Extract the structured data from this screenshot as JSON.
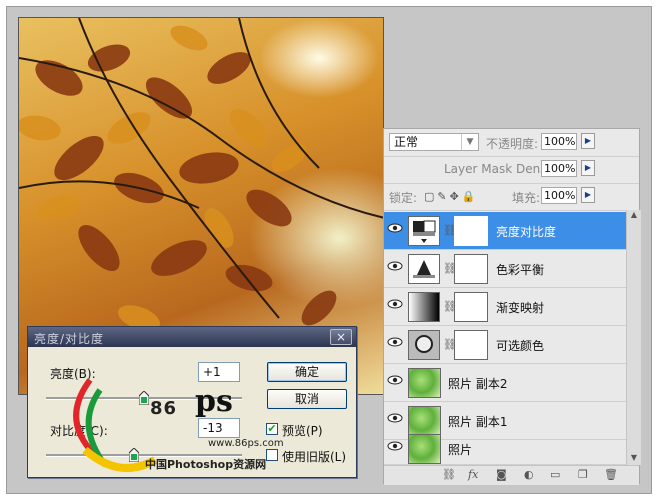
{
  "layers_panel": {
    "blend_mode": "正常",
    "opacity_label": "不透明度:",
    "opacity_value": "100%",
    "density_label": "Layer Mask Density",
    "density_value": "100%",
    "lock_label": "锁定:",
    "fill_label": "填充:",
    "fill_value": "100%",
    "layers": [
      {
        "name": "亮度对比度",
        "selected": true
      },
      {
        "name": "色彩平衡",
        "selected": false
      },
      {
        "name": "渐变映射",
        "selected": false
      },
      {
        "name": "可选颜色",
        "selected": false
      },
      {
        "name": "照片 副本2",
        "selected": false
      },
      {
        "name": "照片 副本1",
        "selected": false
      },
      {
        "name": "照片",
        "selected": false
      }
    ],
    "bottom_icons": [
      "link-icon",
      "fx-icon",
      "mask-icon",
      "adjustment-icon",
      "folder-icon",
      "new-layer-icon",
      "trash-icon"
    ]
  },
  "dialog": {
    "title": "亮度/对比度",
    "close": "×",
    "brightness_label": "亮度(B):",
    "brightness_value": "+1",
    "contrast_label": "对比度(C):",
    "contrast_value": "-13",
    "ok_label": "确定",
    "cancel_label": "取消",
    "preview_label": "预览(P)",
    "preview_checked": true,
    "legacy_label": "使用旧版(L)",
    "legacy_checked": false,
    "brightness_level": 0.5,
    "contrast_level": 0.45
  },
  "watermark": {
    "number": "86",
    "letters": "ps",
    "url": "www.86ps.com",
    "site_name": "中国Photoshop资源网"
  },
  "colors": {
    "selected_layer": "#3d8ee6",
    "dialog_title": "#2c3450",
    "panel_bg": "#e9e9e9"
  }
}
